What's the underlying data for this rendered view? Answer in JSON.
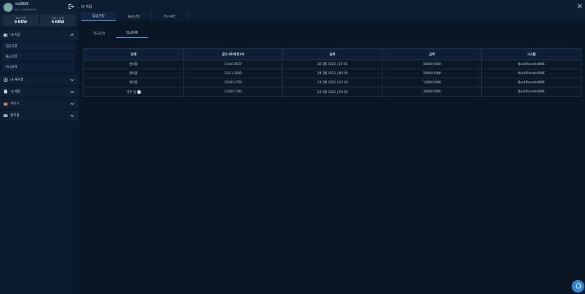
{
  "profile": {
    "username": "nhj3608",
    "user_id": "ID: 1109831550",
    "balances": [
      {
        "label": "보유 잔액",
        "value": "0 KRW"
      },
      {
        "label": "보너스 잔액",
        "value": "0 KRW"
      }
    ]
  },
  "sidebar": {
    "sections": [
      {
        "label": "내 지갑",
        "icon": "wallet-icon",
        "expanded": true
      },
      {
        "label": "내 프로필",
        "icon": "user-icon"
      },
      {
        "label": "내 베팅",
        "icon": "receipt-icon"
      },
      {
        "label": "보너스",
        "icon": "gift-icon"
      },
      {
        "label": "편지함",
        "icon": "mail-icon"
      }
    ],
    "wallet_items": [
      "입금신청",
      "출금신청",
      "머니내역"
    ]
  },
  "header": {
    "title": "내 지갑"
  },
  "tabs": [
    "입금신청",
    "출금신청",
    "머니내역"
  ],
  "subtabs": [
    "입금신청",
    "입금현황"
  ],
  "table": {
    "columns": [
      "상태",
      "참조 ID/예정 ID",
      "날짜",
      "금액",
      "시스템"
    ],
    "rows": [
      {
        "status": "완료됨",
        "ref": "111413637",
        "date": "26 1월 2022 | 17:41",
        "amount": "30000 KRW",
        "system": "BankTransferBME"
      },
      {
        "status": "완료됨",
        "ref": "111111930",
        "date": "24 1월 2022 | 00:36",
        "amount": "10000 KRW",
        "system": "BankTransferBME"
      },
      {
        "status": "완료됨",
        "ref": "111012759",
        "date": "23 1월 2022 | 03:19",
        "amount": "13000 KRW",
        "system": "BankTransferBME"
      },
      {
        "status": "거부 됨",
        "ref": "111011740",
        "date": "23 1월 2022 | 03:12",
        "amount": "10000 KRW",
        "system": "BankTransferBME"
      }
    ]
  },
  "colors": {
    "accent": "#4f9bd9",
    "background": "#0a1526",
    "sidebar": "#0b1a2e",
    "chat_button": "#2e88d4"
  }
}
